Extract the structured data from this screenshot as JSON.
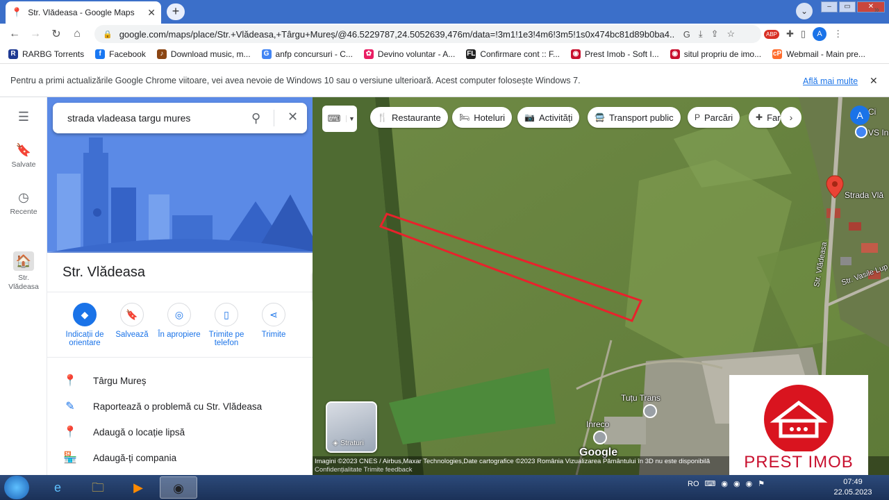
{
  "browser": {
    "tab_title": "Str. Vlădeasa - Google Maps",
    "url": "google.com/maps/place/Str.+Vlădeasa,+Târgu+Mureș/@46.5229787,24.5052639,476m/data=!3m1!1e3!4m6!3m5!1s0x474bc81d89b0ba4...",
    "profile_initial": "A",
    "bookmarks": [
      {
        "label": "RARBG Torrents",
        "icon": "R",
        "color": "#1f3a93"
      },
      {
        "label": "Facebook",
        "icon": "f",
        "color": "#1877f2"
      },
      {
        "label": "Download music, m...",
        "icon": "♪",
        "color": "#8b4513"
      },
      {
        "label": "anfp concursuri - C...",
        "icon": "G",
        "color": "#4285f4"
      },
      {
        "label": "Devino voluntar - A...",
        "icon": "✿",
        "color": "#e91e63"
      },
      {
        "label": "Confirmare cont :: F...",
        "icon": "FL",
        "color": "#222222"
      },
      {
        "label": "Prest Imob - Soft I...",
        "icon": "◉",
        "color": "#c8102e"
      },
      {
        "label": "situl propriu de imo...",
        "icon": "◉",
        "color": "#c8102e"
      },
      {
        "label": "Webmail - Main pre...",
        "icon": "cP",
        "color": "#ff6c2c"
      }
    ],
    "infobar": {
      "message": "Pentru a primi actualizările Google Chrome viitoare, vei avea nevoie de Windows 10 sau o versiune ulterioară. Acest computer folosește Windows 7.",
      "link": "Află mai multe"
    }
  },
  "rail": {
    "saved": "Salvate",
    "recent": "Recente",
    "place": "Str. Vlădeasa"
  },
  "search": {
    "value": "strada vladeasa targu mures"
  },
  "place": {
    "title": "Str. Vlădeasa",
    "actions": [
      {
        "label": "Indicații de orientare",
        "icon": "◆"
      },
      {
        "label": "Salvează",
        "icon": "🔖"
      },
      {
        "label": "În apropiere",
        "icon": "◎"
      },
      {
        "label": "Trimite pe telefon",
        "icon": "▯"
      },
      {
        "label": "Trimite",
        "icon": "⋖"
      }
    ],
    "rows": [
      {
        "label": "Târgu Mureș",
        "icon": "location-pin"
      },
      {
        "label": "Raportează o problemă cu Str. Vlădeasa",
        "icon": "pencil"
      },
      {
        "label": "Adaugă o locație lipsă",
        "icon": "add-location"
      },
      {
        "label": "Adaugă-ți compania",
        "icon": "add-business"
      }
    ]
  },
  "map": {
    "chips": [
      {
        "label": "Restaurante",
        "icon": "🍴"
      },
      {
        "label": "Hoteluri",
        "icon": "🛏"
      },
      {
        "label": "Activități",
        "icon": "📷"
      },
      {
        "label": "Transport public",
        "icon": "🚍"
      },
      {
        "label": "Parcări",
        "icon": "P"
      },
      {
        "label": "Far",
        "icon": "✚"
      }
    ],
    "avatar": "A",
    "labels": {
      "street_pin": "Strada Vlă",
      "street_vert": "Str. Vlădeasa",
      "vasile": "Str. Vasile Lup",
      "tutu": "Tuțu Trans",
      "inreco": "Inreco",
      "cp": "Ci",
      "vs": "VS In"
    },
    "layers_label": "Straturi",
    "google": "Google",
    "attribution_1": "Imagini ©2023 CNES / Airbus,Maxar Technologies,Date cartografice ©2023    România    Vizualizarea Pământului în 3D nu este disponibilă",
    "attribution_2": "Confidențialitate    Trimite feedback"
  },
  "watermark": {
    "text": "PREST IMOB"
  },
  "taskbar": {
    "lang": "RO",
    "time": "07:49",
    "date": "22.05.2023"
  },
  "colors": {
    "accent": "#1a73e8",
    "marker": "#ea4335",
    "boundary": "#e8222c",
    "brand": "#c8102e"
  }
}
